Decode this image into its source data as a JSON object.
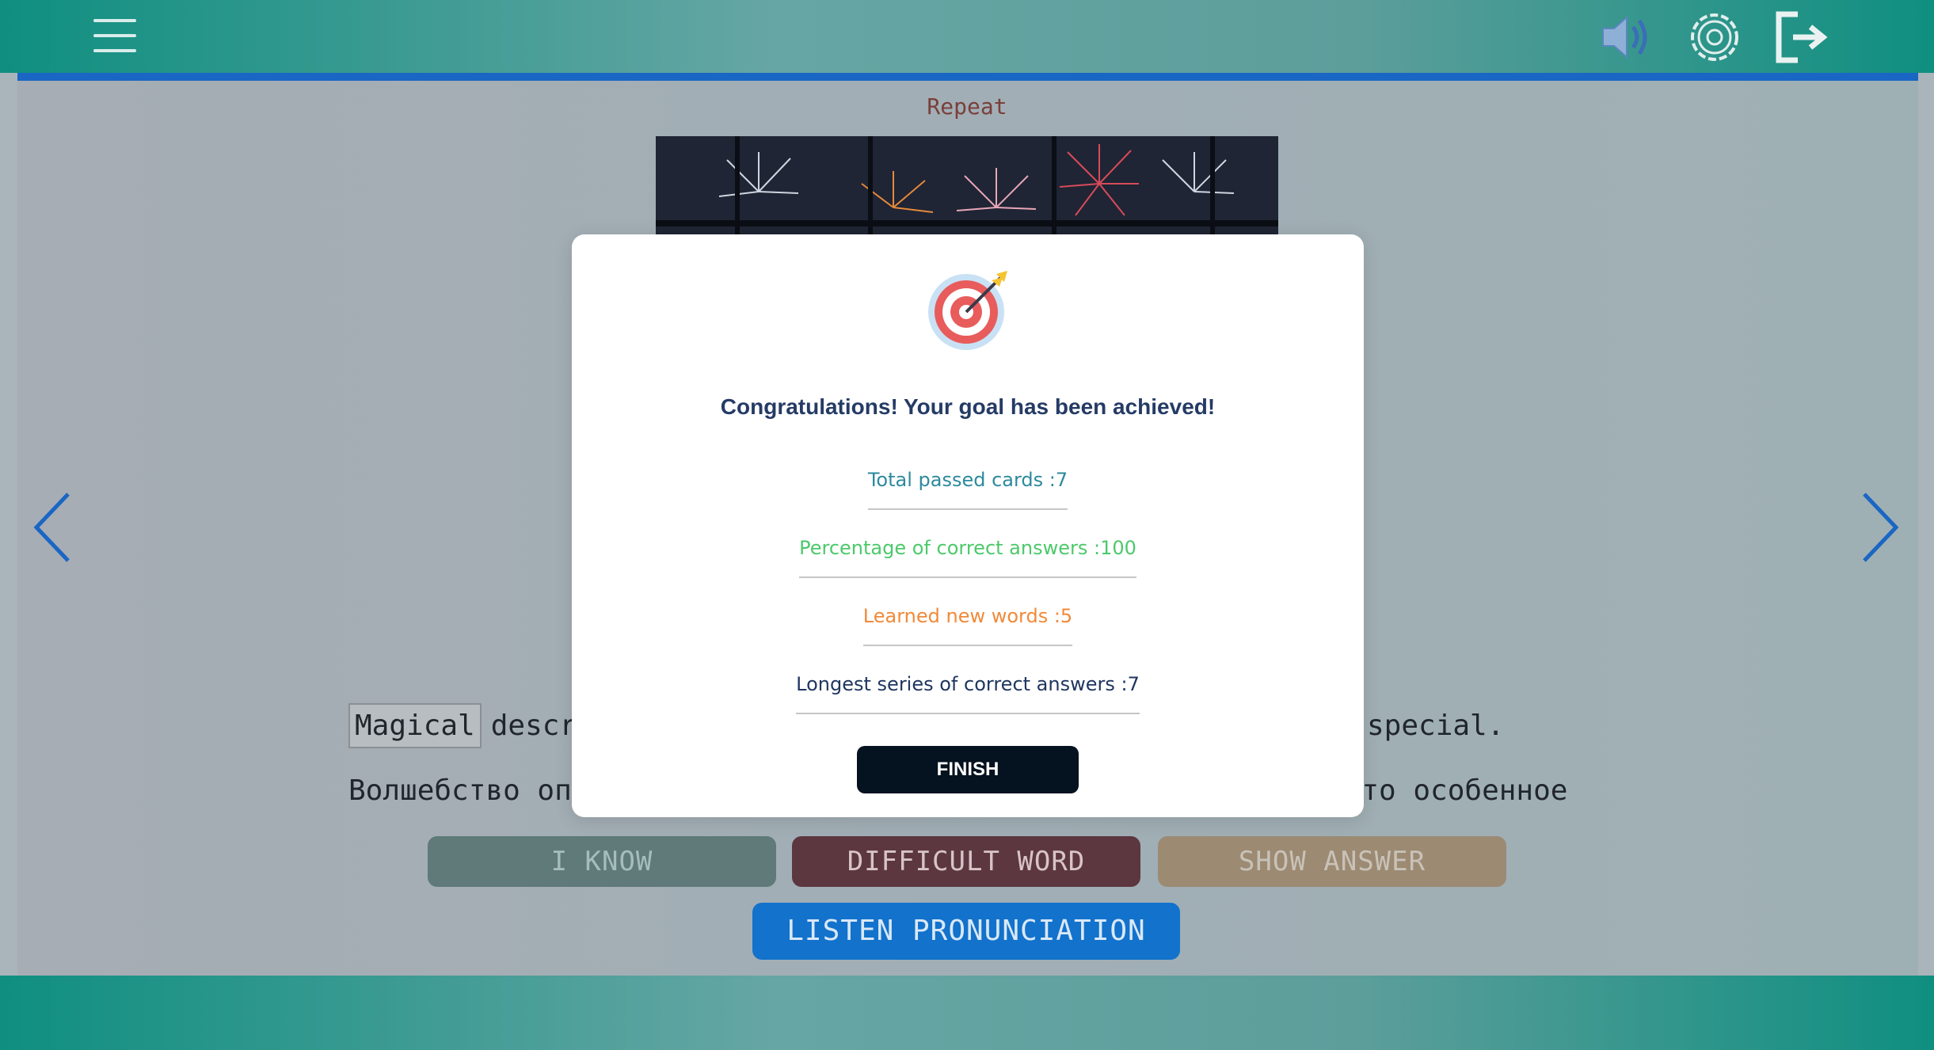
{
  "header": {
    "menu_icon": "hamburger-icon",
    "sound_icon": "speaker-icon",
    "settings_icon": "gear-icon",
    "exit_icon": "logout-icon"
  },
  "card": {
    "mode_label": "Repeat",
    "image": "fireworks-image",
    "word": "Magical",
    "sentence_en_head": "descr",
    "sentence_en_tail": "special.",
    "sentence_ru_head": "Волшебство опи",
    "sentence_ru_tail": "о-то особенное"
  },
  "actions": {
    "know_label": "I KNOW",
    "difficult_label": "DIFFICULT WORD",
    "show_answer_label": "SHOW ANSWER",
    "listen_label": "LISTEN PRONUNCIATION"
  },
  "modal": {
    "icon": "target-icon",
    "title": "Congratulations! Your goal has been achieved!",
    "stats": {
      "total_passed": "Total passed cards :7",
      "percent_correct": "Percentage of correct answers :100",
      "learned_new": "Learned new words :5",
      "longest_series": "Longest series of correct answers :7"
    },
    "finish_label": "FINISH"
  },
  "colors": {
    "header_teal": "#0f8f80",
    "progress_blue": "#1a66c4",
    "finish_dark": "#05121f",
    "title_navy": "#253b66"
  }
}
